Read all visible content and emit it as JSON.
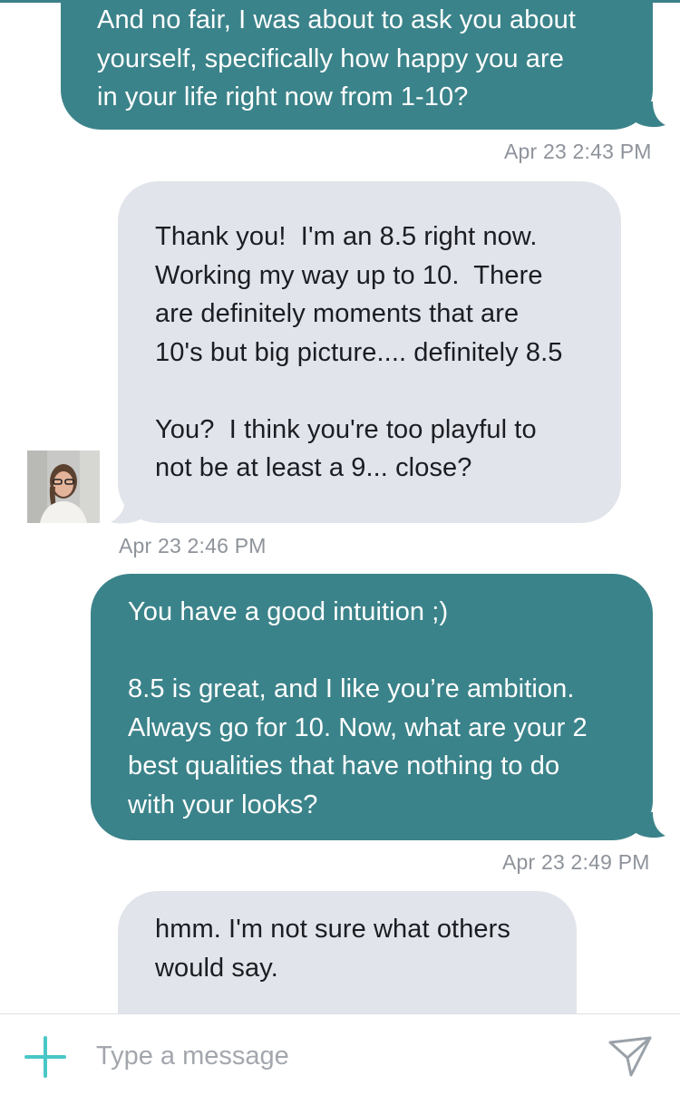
{
  "colors": {
    "outgoing_bubble": "#3b838a",
    "incoming_bubble": "#e1e4ea",
    "accent": "#49c7c7",
    "timestamp": "#8e939b"
  },
  "messages": [
    {
      "direction": "outgoing",
      "text": "And no fair, I was about to ask you about\nyourself, specifically how happy you are\nin your life right now from 1-10?",
      "timestamp": "Apr 23 2:43 PM"
    },
    {
      "direction": "incoming",
      "text": "Thank you!  I'm an 8.5 right now.\nWorking my way up to 10.  There\nare definitely moments that are\n10's but big picture.... definitely 8.5\n\nYou?  I think you're too playful to\nnot be at least a 9... close?",
      "timestamp": "Apr 23 2:46 PM",
      "avatar_icon": "profile-photo"
    },
    {
      "direction": "outgoing",
      "text": "You have a good intuition ;)\n\n8.5 is great, and I like you’re ambition.\nAlways go for 10. Now, what are your 2\nbest qualities that have nothing to do\nwith your looks?",
      "timestamp": "Apr 23 2:49 PM"
    },
    {
      "direction": "incoming",
      "text": "hmm. I'm not sure what others\nwould say.",
      "timestamp": ""
    }
  ],
  "composer": {
    "placeholder": "Type a message",
    "attach_icon": "plus-icon",
    "send_icon": "send-icon"
  }
}
